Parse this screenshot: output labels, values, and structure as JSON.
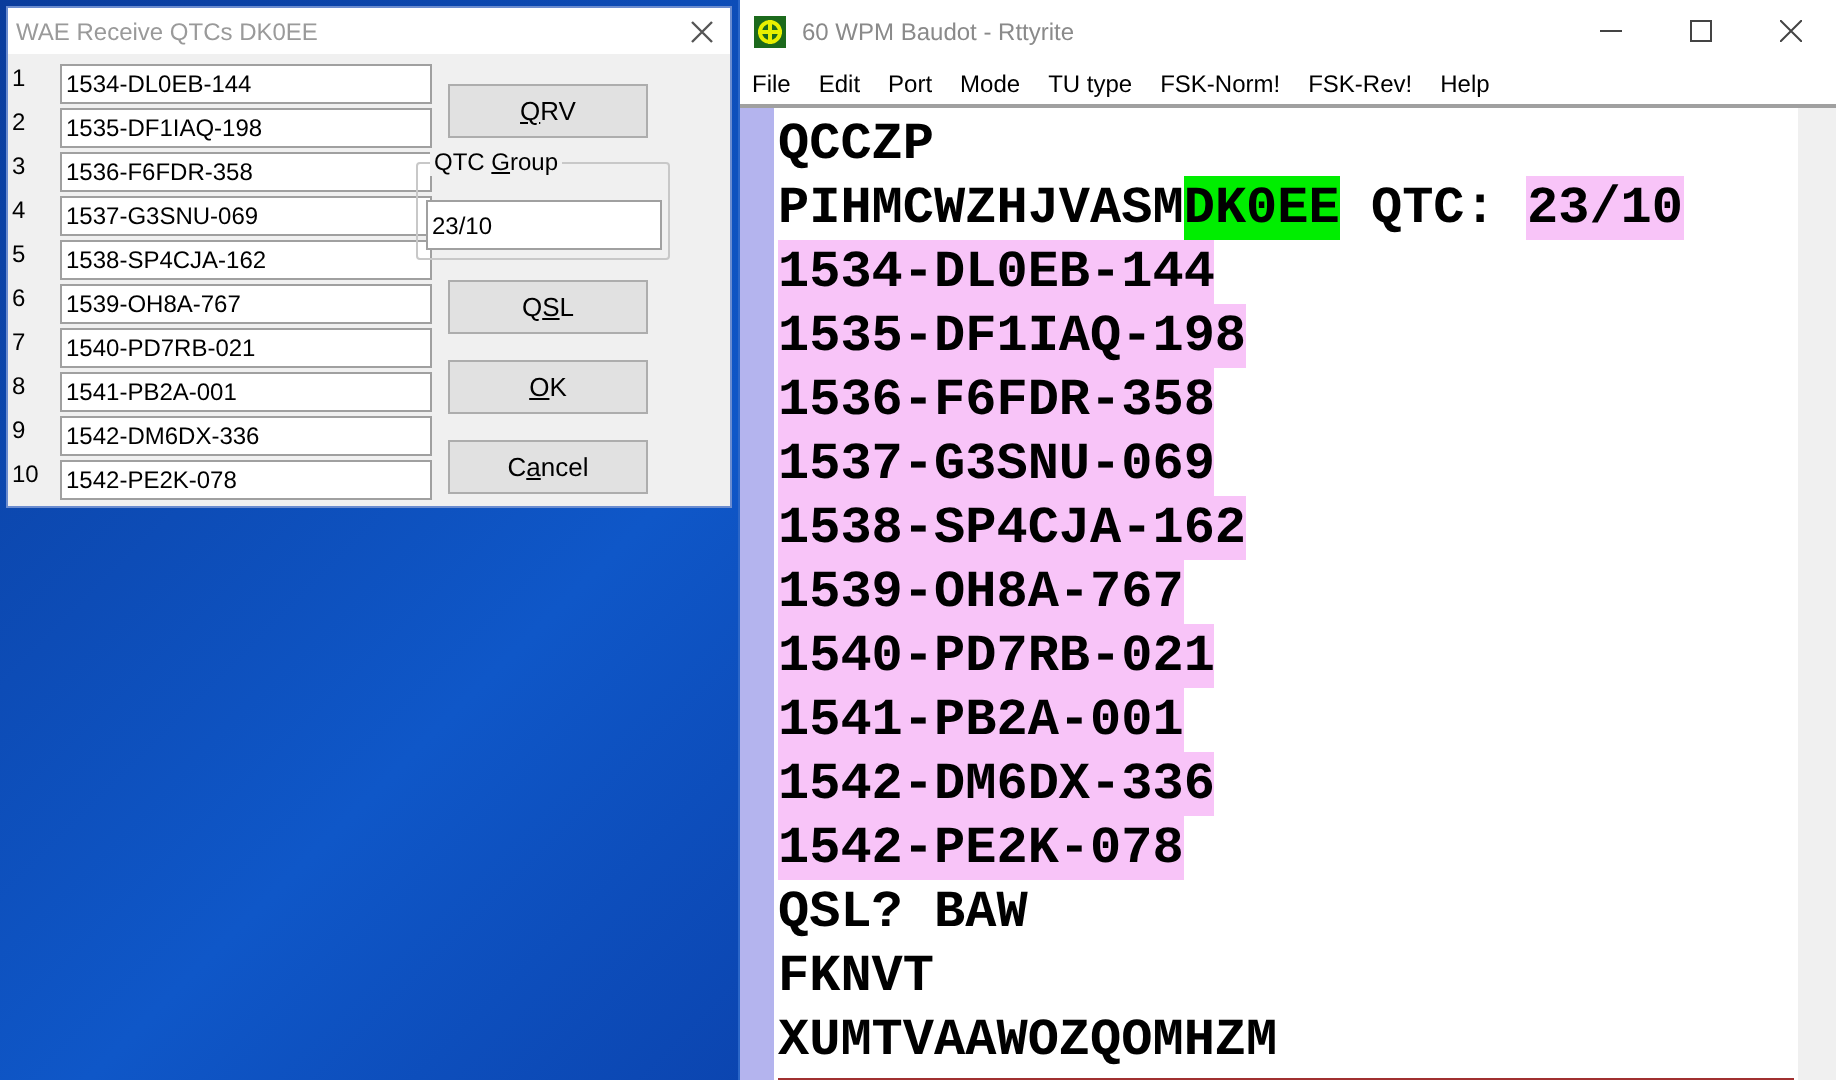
{
  "dialog": {
    "title": "WAE Receive QTCs DK0EE",
    "rows": [
      {
        "number": "1",
        "value": "1534-DL0EB-144"
      },
      {
        "number": "2",
        "value": "1535-DF1IAQ-198"
      },
      {
        "number": "3",
        "value": "1536-F6FDR-358"
      },
      {
        "number": "4",
        "value": "1537-G3SNU-069"
      },
      {
        "number": "5",
        "value": "1538-SP4CJA-162"
      },
      {
        "number": "6",
        "value": "1539-OH8A-767"
      },
      {
        "number": "7",
        "value": "1540-PD7RB-021"
      },
      {
        "number": "8",
        "value": "1541-PB2A-001"
      },
      {
        "number": "9",
        "value": "1542-DM6DX-336"
      },
      {
        "number": "10",
        "value": "1542-PE2K-078"
      }
    ],
    "qtc_group": {
      "label_parts": [
        {
          "text": "QTC ",
          "underlined": false
        },
        {
          "text": "G",
          "underlined": true
        },
        {
          "text": "roup",
          "underlined": false
        }
      ],
      "value": "23/10"
    },
    "buttons": [
      {
        "label_parts": [
          {
            "text": "Q",
            "underlined": true
          },
          {
            "text": "RV",
            "underlined": false
          }
        ]
      },
      {
        "label_parts": [
          {
            "text": "Q",
            "underlined": false
          },
          {
            "text": "S",
            "underlined": true
          },
          {
            "text": "L",
            "underlined": false
          }
        ]
      },
      {
        "label_parts": [
          {
            "text": "O",
            "underlined": true
          },
          {
            "text": "K",
            "underlined": false
          }
        ]
      },
      {
        "label_parts": [
          {
            "text": "C",
            "underlined": false
          },
          {
            "text": "a",
            "underlined": true
          },
          {
            "text": "ncel",
            "underlined": false
          }
        ]
      }
    ]
  },
  "window": {
    "title": "60 WPM Baudot - Rttyrite",
    "menu": [
      "File",
      "Edit",
      "Port",
      "Mode",
      "TU type",
      "FSK-Norm!",
      "FSK-Rev!",
      "Help"
    ],
    "lines": [
      [
        {
          "text": "QCCZP"
        }
      ],
      [
        {
          "text": "PIHMCWZHJVASM"
        },
        {
          "text": "DK0EE",
          "color": "#00ee00"
        },
        {
          "text": " QTC: "
        },
        {
          "text": "23/10",
          "color": "#f8c4f8"
        }
      ],
      [
        {
          "text": "1534-DL0EB-144",
          "color": "#f8c4f8"
        }
      ],
      [
        {
          "text": "1535-DF1IAQ-198",
          "color": "#f8c4f8"
        }
      ],
      [
        {
          "text": "1536-F6FDR-358",
          "color": "#f8c4f8"
        }
      ],
      [
        {
          "text": "1537-G3SNU-069",
          "color": "#f8c4f8"
        }
      ],
      [
        {
          "text": "1538-SP4CJA-162",
          "color": "#f8c4f8"
        }
      ],
      [
        {
          "text": "1539-OH8A-767",
          "color": "#f8c4f8"
        }
      ],
      [
        {
          "text": "1540-PD7RB-021",
          "color": "#f8c4f8"
        }
      ],
      [
        {
          "text": "1541-PB2A-001",
          "color": "#f8c4f8"
        }
      ],
      [
        {
          "text": "1542-DM6DX-336",
          "color": "#f8c4f8"
        }
      ],
      [
        {
          "text": "1542-PE2K-078",
          "color": "#f8c4f8"
        }
      ],
      [
        {
          "text": "QSL? BAW"
        }
      ],
      [
        {
          "text": "FKNVT"
        }
      ],
      [
        {
          "text": "XUMTVAAWOZQOMHZM"
        }
      ]
    ]
  }
}
